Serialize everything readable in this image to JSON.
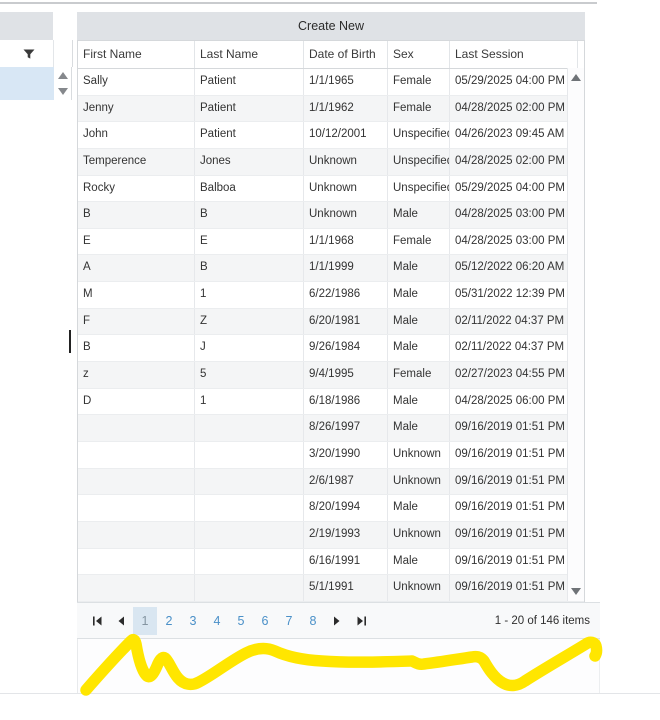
{
  "table": {
    "create_new_label": "Create New",
    "columns": [
      "First Name",
      "Last Name",
      "Date of Birth",
      "Sex",
      "Last Session"
    ],
    "rows": [
      {
        "first_name": "Sally",
        "last_name": "Patient",
        "date_of_birth": "1/1/1965",
        "sex": "Female",
        "last_session": "05/29/2025 04:00 PM"
      },
      {
        "first_name": "Jenny",
        "last_name": "Patient",
        "date_of_birth": "1/1/1962",
        "sex": "Female",
        "last_session": "04/28/2025 02:00 PM"
      },
      {
        "first_name": "John",
        "last_name": "Patient",
        "date_of_birth": "10/12/2001",
        "sex": "Unspecified",
        "last_session": "04/26/2023 09:45 AM"
      },
      {
        "first_name": "Temperence",
        "last_name": "Jones",
        "date_of_birth": "Unknown",
        "sex": "Unspecified",
        "last_session": "04/28/2025 02:00 PM"
      },
      {
        "first_name": "Rocky",
        "last_name": "Balboa",
        "date_of_birth": "Unknown",
        "sex": "Unspecified",
        "last_session": "05/29/2025 04:00 PM"
      },
      {
        "first_name": "B",
        "last_name": "B",
        "date_of_birth": "Unknown",
        "sex": "Male",
        "last_session": "04/28/2025 03:00 PM"
      },
      {
        "first_name": "E",
        "last_name": "E",
        "date_of_birth": "1/1/1968",
        "sex": "Female",
        "last_session": "04/28/2025 03:00 PM"
      },
      {
        "first_name": "A",
        "last_name": "B",
        "date_of_birth": "1/1/1999",
        "sex": "Male",
        "last_session": "05/12/2022 06:20 AM"
      },
      {
        "first_name": "M",
        "last_name": "1",
        "date_of_birth": "6/22/1986",
        "sex": "Male",
        "last_session": "05/31/2022 12:39 PM"
      },
      {
        "first_name": "F",
        "last_name": "Z",
        "date_of_birth": "6/20/1981",
        "sex": "Male",
        "last_session": "02/11/2022 04:37 PM"
      },
      {
        "first_name": "B",
        "last_name": "J",
        "date_of_birth": "9/26/1984",
        "sex": "Male",
        "last_session": "02/11/2022 04:37 PM"
      },
      {
        "first_name": "z",
        "last_name": "5",
        "date_of_birth": "9/4/1995",
        "sex": "Female",
        "last_session": "02/27/2023 04:55 PM"
      },
      {
        "first_name": "D",
        "last_name": "1",
        "date_of_birth": "6/18/1986",
        "sex": "Male",
        "last_session": "04/28/2025 06:00 PM"
      },
      {
        "first_name": "",
        "last_name": "",
        "date_of_birth": "8/26/1997",
        "sex": "Male",
        "last_session": "09/16/2019 01:51 PM"
      },
      {
        "first_name": "",
        "last_name": "",
        "date_of_birth": "3/20/1990",
        "sex": "Unknown",
        "last_session": "09/16/2019 01:51 PM"
      },
      {
        "first_name": "",
        "last_name": "",
        "date_of_birth": "2/6/1987",
        "sex": "Unknown",
        "last_session": "09/16/2019 01:51 PM"
      },
      {
        "first_name": "",
        "last_name": "",
        "date_of_birth": "8/20/1994",
        "sex": "Male",
        "last_session": "09/16/2019 01:51 PM"
      },
      {
        "first_name": "",
        "last_name": "",
        "date_of_birth": "2/19/1993",
        "sex": "Unknown",
        "last_session": "09/16/2019 01:51 PM"
      },
      {
        "first_name": "",
        "last_name": "",
        "date_of_birth": "6/16/1991",
        "sex": "Male",
        "last_session": "09/16/2019 01:51 PM"
      },
      {
        "first_name": "",
        "last_name": "",
        "date_of_birth": "5/1/1991",
        "sex": "Unknown",
        "last_session": "09/16/2019 01:51 PM"
      }
    ]
  },
  "pagination": {
    "pages": [
      "1",
      "2",
      "3",
      "4",
      "5",
      "6",
      "7",
      "8"
    ],
    "current_page": "1",
    "summary": "1 - 20 of 146 items"
  },
  "icons": {
    "filter": "funnel",
    "scroll_up": "triangle-up",
    "scroll_down": "triangle-down",
    "first_page": "bar-left-triangle",
    "prev_page": "left-triangle",
    "next_page": "right-triangle",
    "last_page": "right-triangle-bar"
  },
  "annotation": {
    "type": "freehand-scribble",
    "color": "#FFE600"
  },
  "colors": {
    "button_gray": "#dfe2e6",
    "alt_row": "#f4f5f6",
    "selected_page_bg": "#d9e6f1",
    "page_link": "#4a90c8",
    "left_selected_box": "#d8e7f5",
    "pager_bg": "#f8f9fa"
  }
}
